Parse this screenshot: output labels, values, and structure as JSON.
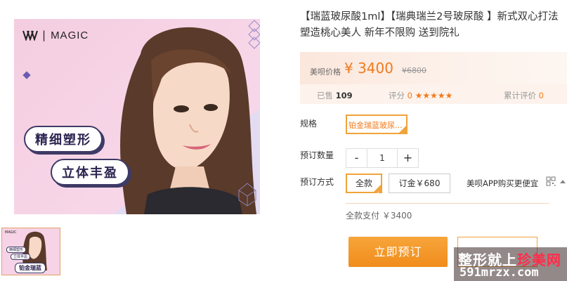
{
  "hero": {
    "brand": "MAGIC",
    "tag1": "精细塑形",
    "tag2": "立体丰盈"
  },
  "thumb": {
    "label": "铂金瑞蓝",
    "mini1": "精细塑形",
    "mini2": "立体丰盈",
    "brand": "MAGIC"
  },
  "product": {
    "title": "【瑞蓝玻尿酸1ml】【瑞典瑞兰2号玻尿酸 】新式双心打法 塑造桃心美人 新年不限购 送到院礼"
  },
  "price": {
    "label": "美呗价格",
    "current": "¥ 3400",
    "original": "¥6800"
  },
  "stats": {
    "sold_label": "已售",
    "sold_value": "109",
    "rating_label": "评分",
    "rating_value": "0",
    "stars": "★★★★★",
    "reviews_label": "累计评价",
    "reviews_value": "0"
  },
  "spec": {
    "label": "规格",
    "selected": "铂金瑞蓝玻尿..."
  },
  "quantity": {
    "label": "预订数量",
    "minus": "-",
    "value": "1",
    "plus": "+"
  },
  "payment": {
    "label": "预订方式",
    "full": "全款",
    "deposit": "订金￥680",
    "app_buy": "美呗APP购买更便宜",
    "full_pay": "全款支付 ￥3400"
  },
  "actions": {
    "buy": "立即预订"
  },
  "watermark": {
    "line1_a": "整形就上",
    "line1_b": "珍美网",
    "line2": "591mrzx.com"
  },
  "colors": {
    "accent": "#f07a1e",
    "border_accent": "#f0a33a"
  }
}
